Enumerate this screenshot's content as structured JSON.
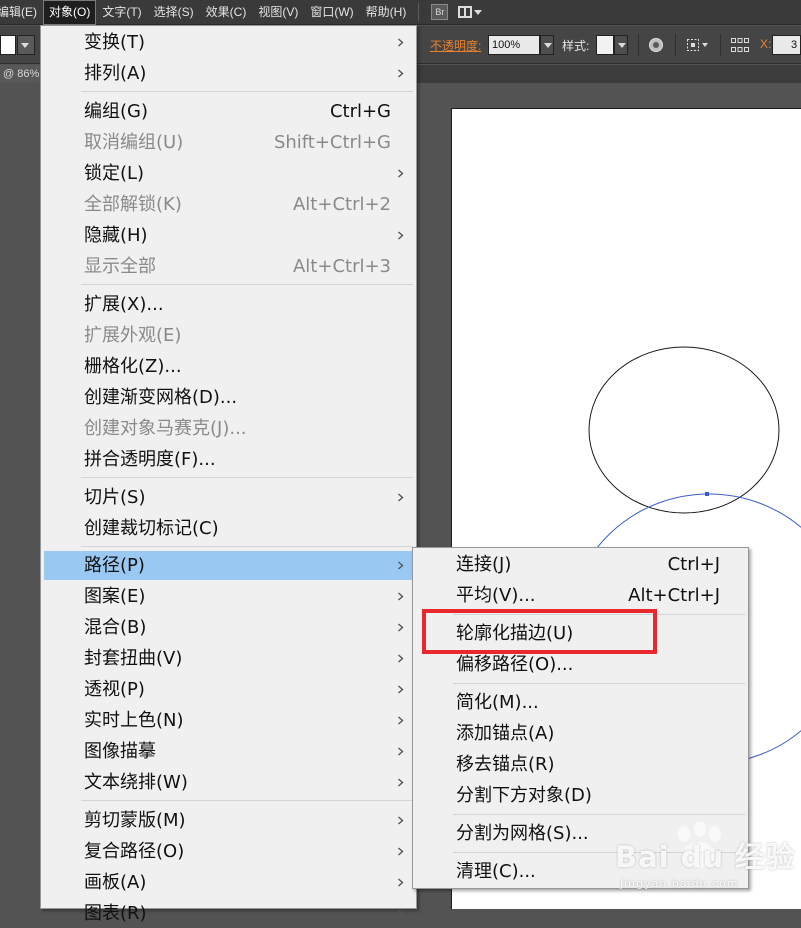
{
  "menubar": {
    "items": [
      {
        "label": "编辑(E)"
      },
      {
        "label": "对象(O)"
      },
      {
        "label": "文字(T)"
      },
      {
        "label": "选择(S)"
      },
      {
        "label": "效果(C)"
      },
      {
        "label": "视图(V)"
      },
      {
        "label": "窗口(W)"
      },
      {
        "label": "帮助(H)"
      }
    ],
    "bridge_label": "Br"
  },
  "controlbar": {
    "opacity_label": "不透明度:",
    "opacity_value": "100%",
    "style_label": "样式:",
    "x_label": "X:",
    "x_value": "3"
  },
  "doc_tab": {
    "label": "@ 86%"
  },
  "object_menu": {
    "items": [
      {
        "label": "变换(T)",
        "shortcut": "",
        "submenu": true,
        "disabled": false
      },
      {
        "label": "排列(A)",
        "shortcut": "",
        "submenu": true,
        "disabled": false
      },
      {
        "label": "编组(G)",
        "shortcut": "Ctrl+G",
        "submenu": false,
        "disabled": false
      },
      {
        "label": "取消编组(U)",
        "shortcut": "Shift+Ctrl+G",
        "submenu": false,
        "disabled": true
      },
      {
        "label": "锁定(L)",
        "shortcut": "",
        "submenu": true,
        "disabled": false
      },
      {
        "label": "全部解锁(K)",
        "shortcut": "Alt+Ctrl+2",
        "submenu": false,
        "disabled": true
      },
      {
        "label": "隐藏(H)",
        "shortcut": "",
        "submenu": true,
        "disabled": false
      },
      {
        "label": "显示全部",
        "shortcut": "Alt+Ctrl+3",
        "submenu": false,
        "disabled": true
      },
      {
        "label": "扩展(X)...",
        "shortcut": "",
        "submenu": false,
        "disabled": false
      },
      {
        "label": "扩展外观(E)",
        "shortcut": "",
        "submenu": false,
        "disabled": true
      },
      {
        "label": "栅格化(Z)...",
        "shortcut": "",
        "submenu": false,
        "disabled": false
      },
      {
        "label": "创建渐变网格(D)...",
        "shortcut": "",
        "submenu": false,
        "disabled": false
      },
      {
        "label": "创建对象马赛克(J)...",
        "shortcut": "",
        "submenu": false,
        "disabled": true
      },
      {
        "label": "拼合透明度(F)...",
        "shortcut": "",
        "submenu": false,
        "disabled": false
      },
      {
        "label": "切片(S)",
        "shortcut": "",
        "submenu": true,
        "disabled": false
      },
      {
        "label": "创建裁切标记(C)",
        "shortcut": "",
        "submenu": false,
        "disabled": false
      },
      {
        "label": "路径(P)",
        "shortcut": "",
        "submenu": true,
        "disabled": false,
        "active": true
      },
      {
        "label": "图案(E)",
        "shortcut": "",
        "submenu": true,
        "disabled": false
      },
      {
        "label": "混合(B)",
        "shortcut": "",
        "submenu": true,
        "disabled": false
      },
      {
        "label": "封套扭曲(V)",
        "shortcut": "",
        "submenu": true,
        "disabled": false
      },
      {
        "label": "透视(P)",
        "shortcut": "",
        "submenu": true,
        "disabled": false
      },
      {
        "label": "实时上色(N)",
        "shortcut": "",
        "submenu": true,
        "disabled": false
      },
      {
        "label": "图像描摹",
        "shortcut": "",
        "submenu": true,
        "disabled": false
      },
      {
        "label": "文本绕排(W)",
        "shortcut": "",
        "submenu": true,
        "disabled": false
      },
      {
        "label": "剪切蒙版(M)",
        "shortcut": "",
        "submenu": true,
        "disabled": false
      },
      {
        "label": "复合路径(O)",
        "shortcut": "",
        "submenu": true,
        "disabled": false
      },
      {
        "label": "画板(A)",
        "shortcut": "",
        "submenu": true,
        "disabled": false
      },
      {
        "label": "图表(R)",
        "shortcut": "",
        "submenu": true,
        "disabled": false
      }
    ]
  },
  "path_submenu": {
    "items": [
      {
        "label": "连接(J)",
        "shortcut": "Ctrl+J"
      },
      {
        "label": "平均(V)...",
        "shortcut": "Alt+Ctrl+J"
      },
      {
        "label": "轮廓化描边(U)",
        "shortcut": "",
        "highlighted": true
      },
      {
        "label": "偏移路径(O)...",
        "shortcut": ""
      },
      {
        "label": "简化(M)...",
        "shortcut": ""
      },
      {
        "label": "添加锚点(A)",
        "shortcut": ""
      },
      {
        "label": "移去锚点(R)",
        "shortcut": ""
      },
      {
        "label": "分割下方对象(D)",
        "shortcut": ""
      },
      {
        "label": "分割为网格(S)...",
        "shortcut": ""
      },
      {
        "label": "清理(C)...",
        "shortcut": ""
      }
    ]
  },
  "watermark": {
    "text": "Bai du 经验",
    "url": "jingyan.baidu.com"
  },
  "colors": {
    "menu_bg": "#f0f0f0",
    "menu_active": "#99c9f2",
    "highlight_box": "#e8282c",
    "opacity_label": "#e8822c",
    "selected_path": "#3a5fcd"
  }
}
